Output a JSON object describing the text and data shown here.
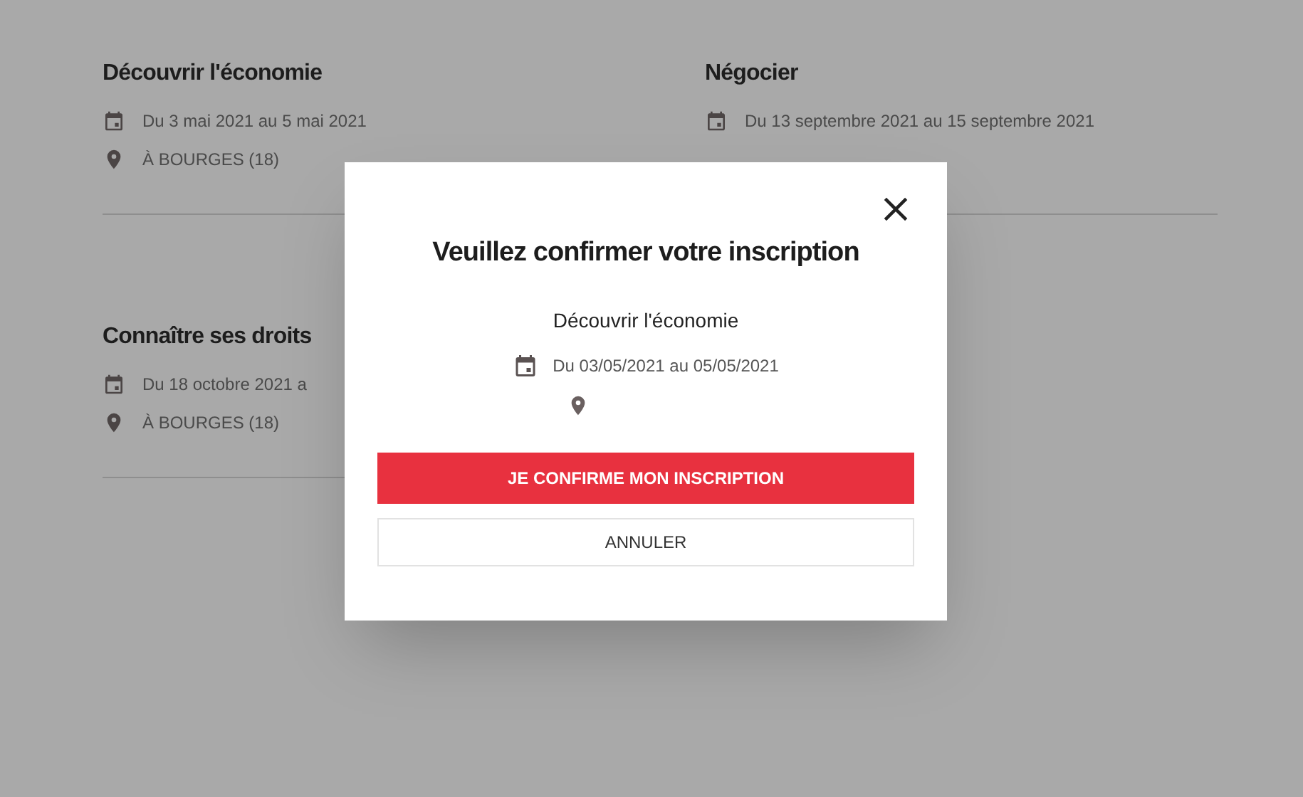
{
  "events": [
    {
      "title": "Découvrir l'économie",
      "date": "Du 3 mai 2021 au 5 mai 2021",
      "location": "À BOURGES (18)"
    },
    {
      "title": "Négocier",
      "date": "Du 13 septembre 2021 au 15 septembre 2021"
    },
    {
      "title": "Connaître ses droits",
      "date": "Du 18 octobre 2021 a",
      "location": "À BOURGES (18)"
    }
  ],
  "dialog": {
    "title": "Veuillez confirmer votre inscription",
    "event_name": "Découvrir l'économie",
    "date": "Du 03/05/2021 au 05/05/2021",
    "confirm_button": "JE CONFIRME MON INSCRIPTION",
    "cancel_button": "ANNULER"
  }
}
